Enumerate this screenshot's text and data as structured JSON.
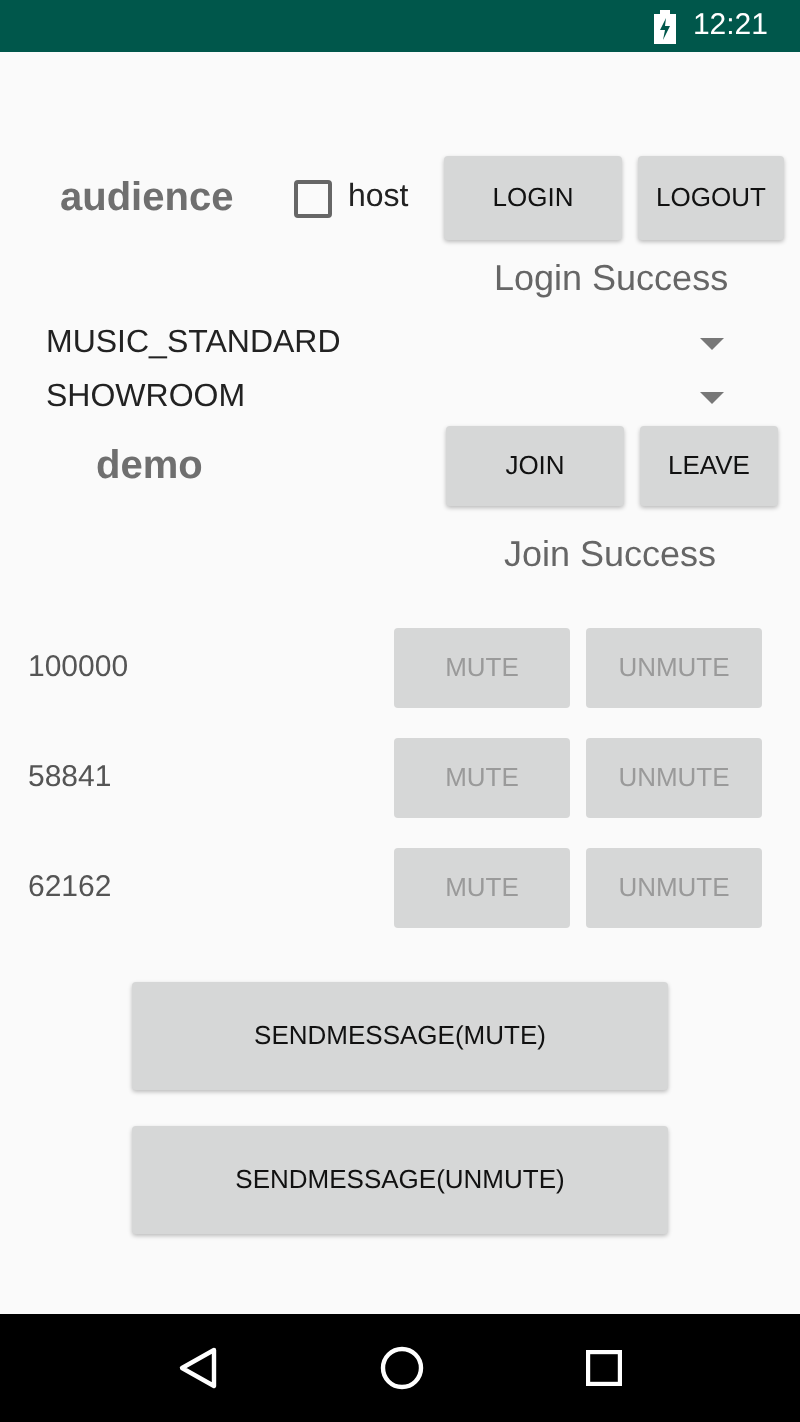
{
  "status_bar": {
    "time": "12:21"
  },
  "role": {
    "label": "audience",
    "host_label": "host",
    "host_checked": false
  },
  "login_buttons": [
    {
      "label": "LOGIN",
      "disabled": false
    },
    {
      "label": "LOGOUT",
      "disabled": false
    }
  ],
  "login_status": "Login Success",
  "spinners": [
    {
      "value": "MUSIC_STANDARD"
    },
    {
      "value": "SHOWROOM"
    }
  ],
  "room": {
    "name": "demo"
  },
  "room_buttons": [
    {
      "label": "JOIN",
      "disabled": false
    },
    {
      "label": "LEAVE",
      "disabled": false
    }
  ],
  "join_status": "Join Success",
  "users": [
    {
      "uid": "100000",
      "buttons": [
        {
          "label": "MUTE",
          "disabled": true
        },
        {
          "label": "UNMUTE",
          "disabled": true
        }
      ]
    },
    {
      "uid": "58841",
      "buttons": [
        {
          "label": "MUTE",
          "disabled": true
        },
        {
          "label": "UNMUTE",
          "disabled": true
        }
      ]
    },
    {
      "uid": "62162",
      "buttons": [
        {
          "label": "MUTE",
          "disabled": true
        },
        {
          "label": "UNMUTE",
          "disabled": true
        }
      ]
    }
  ],
  "message_buttons": [
    {
      "label": "SENDMESSAGE(MUTE)",
      "disabled": false
    },
    {
      "label": "SENDMESSAGE(UNMUTE)",
      "disabled": false
    }
  ]
}
